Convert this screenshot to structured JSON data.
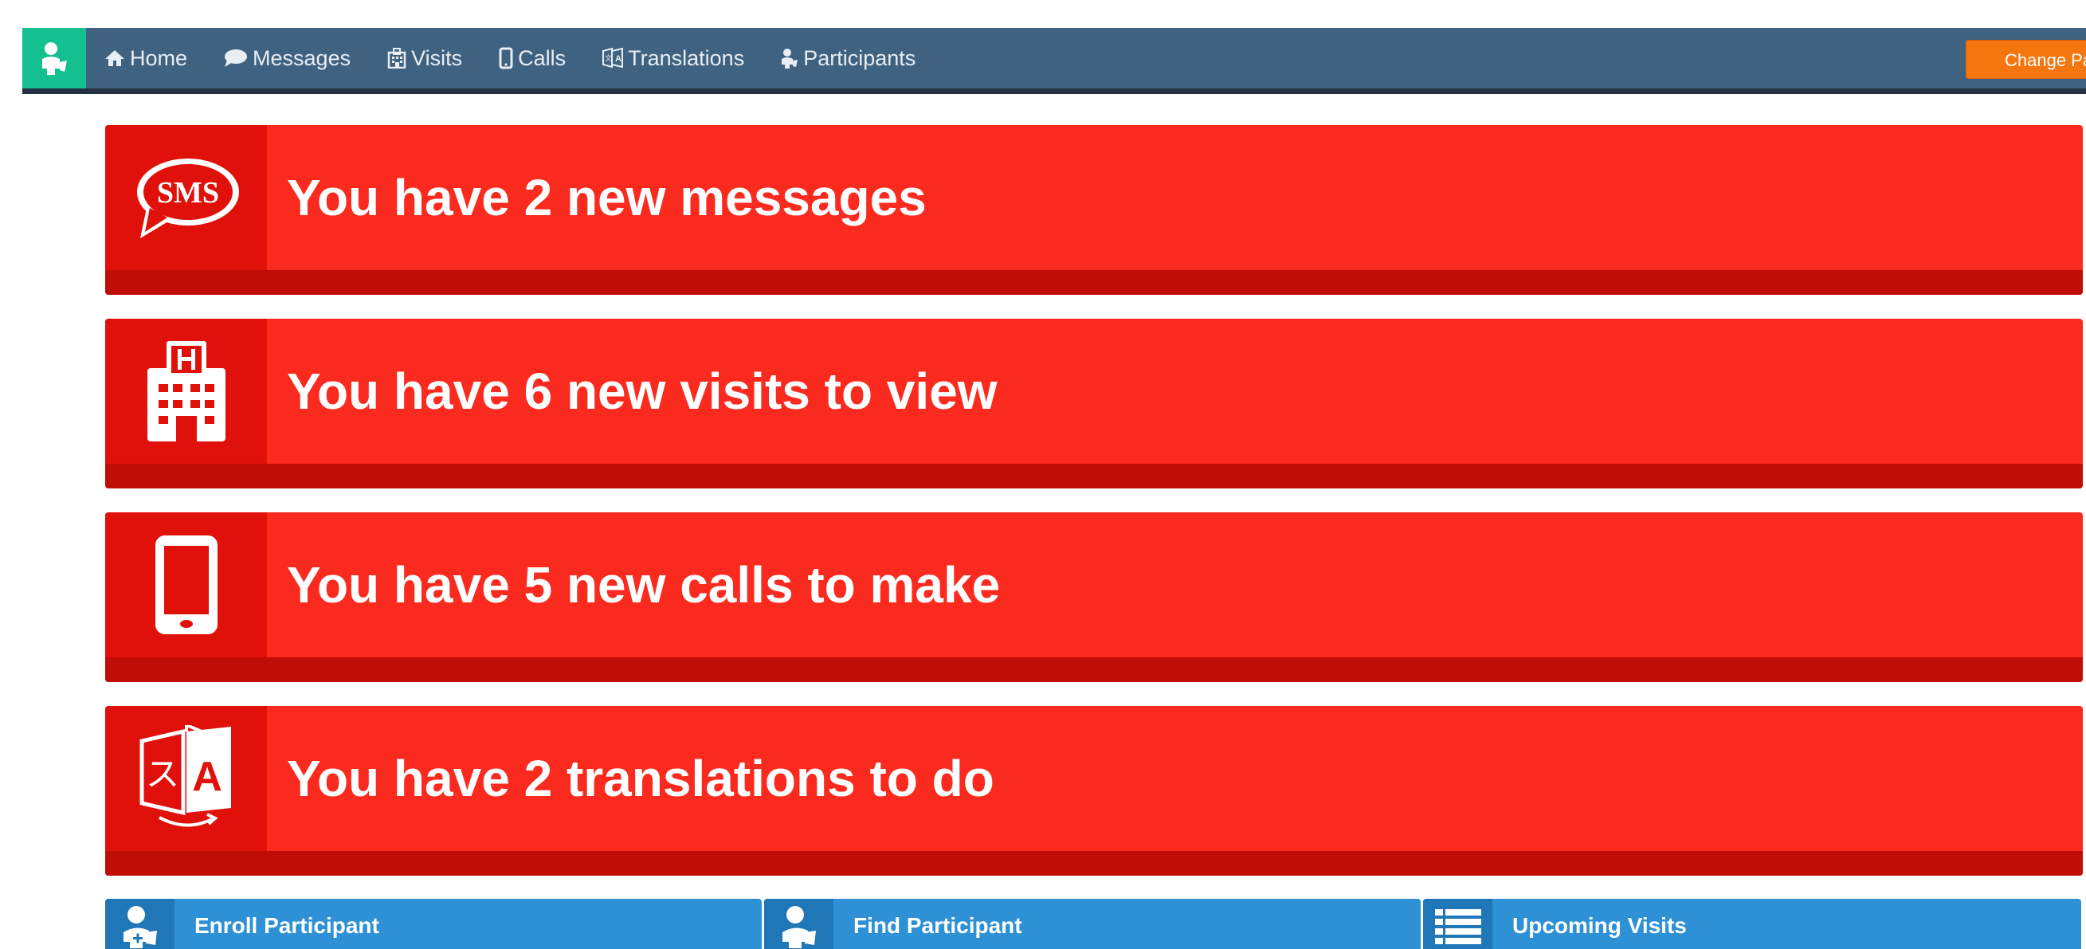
{
  "nav": {
    "items": [
      {
        "label": "Home",
        "icon": "home-icon"
      },
      {
        "label": "Messages",
        "icon": "speech-bubble-icon"
      },
      {
        "label": "Visits",
        "icon": "hospital-icon"
      },
      {
        "label": "Calls",
        "icon": "phone-icon"
      },
      {
        "label": "Translations",
        "icon": "translate-icon"
      },
      {
        "label": "Participants",
        "icon": "participant-icon"
      }
    ],
    "change_password_label": "Change Pass"
  },
  "alerts": [
    {
      "text": "You have 2 new messages",
      "icon": "sms-icon"
    },
    {
      "text": "You have 6 new visits to view",
      "icon": "hospital-icon"
    },
    {
      "text": "You have 5 new calls to make",
      "icon": "mobile-phone-icon"
    },
    {
      "text": "You have 2 translations to do",
      "icon": "translate-icon"
    }
  ],
  "tiles": [
    {
      "label": "Enroll Participant",
      "icon": "enroll-participant-icon"
    },
    {
      "label": "Find Participant",
      "icon": "find-participant-icon"
    },
    {
      "label": "Upcoming Visits",
      "icon": "list-icon"
    }
  ],
  "colors": {
    "navbar": "#3f6281",
    "brand": "#14c08f",
    "alert": "#fb2a1f",
    "alert_icon_bg": "#e0110a",
    "alert_footer": "#c00e06",
    "tile": "#2e91d6",
    "change_pass": "#f5750f"
  }
}
